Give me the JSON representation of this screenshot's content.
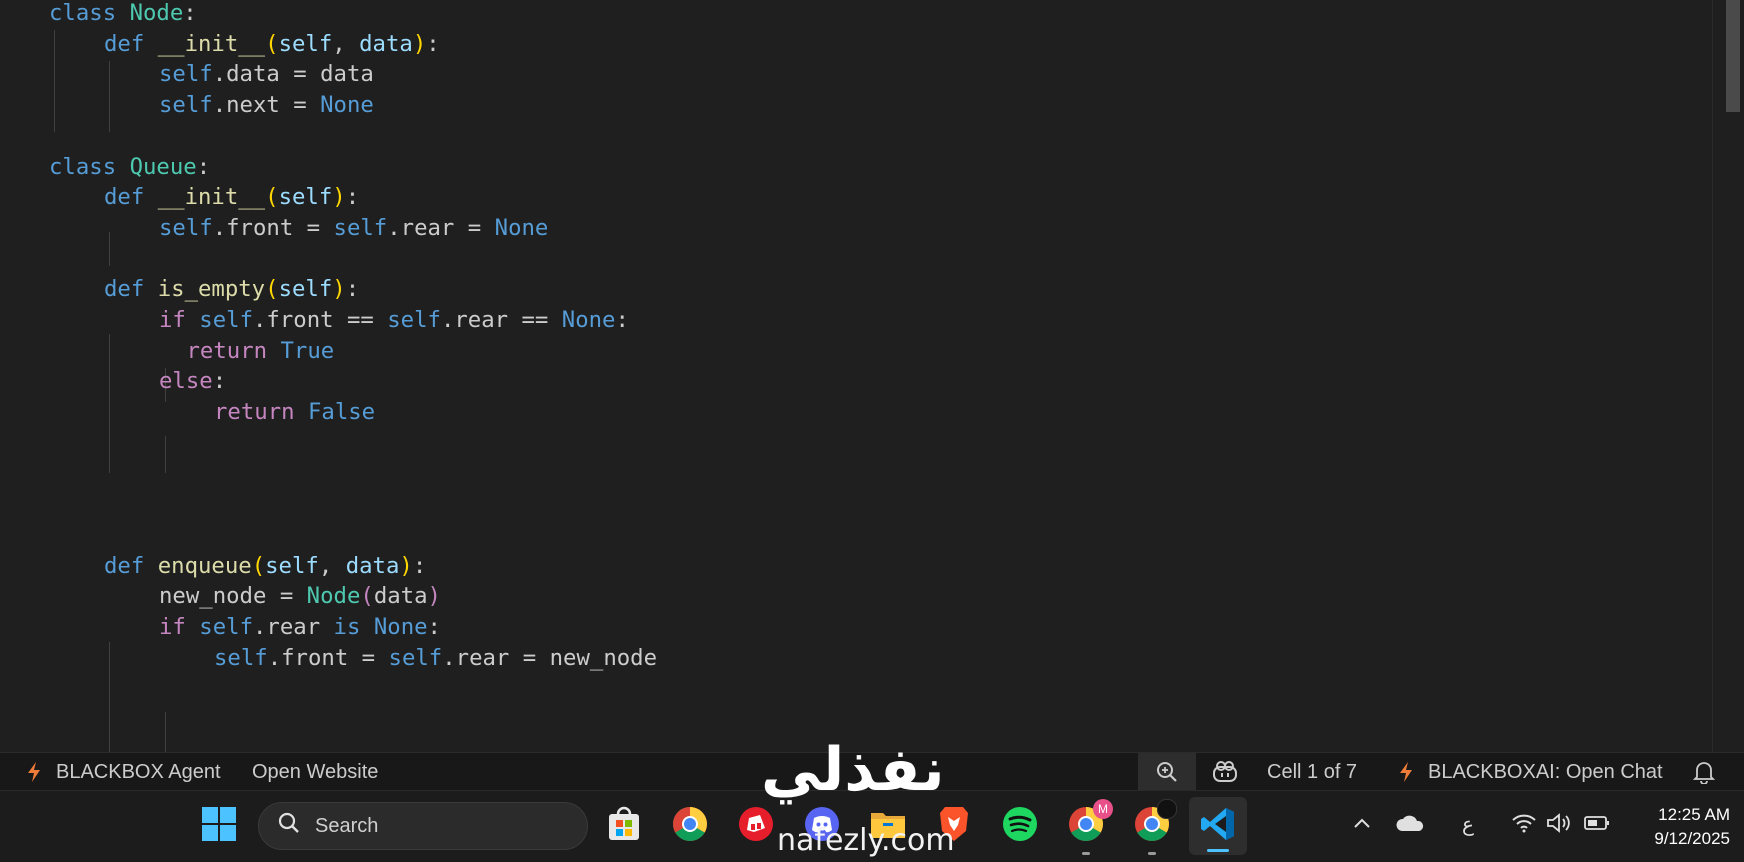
{
  "editor": {
    "code_lines": [
      {
        "indent": 1,
        "tokens": [
          {
            "t": "class",
            "c": "kw"
          },
          {
            "t": " "
          },
          {
            "t": "Node",
            "c": "cls"
          },
          {
            "t": ":"
          }
        ]
      },
      {
        "indent": 2,
        "tokens": [
          {
            "t": "def",
            "c": "kw"
          },
          {
            "t": " "
          },
          {
            "t": "__init__",
            "c": "fn"
          },
          {
            "t": "(",
            "c": "brk"
          },
          {
            "t": "self",
            "c": "prm"
          },
          {
            "t": ", "
          },
          {
            "t": "data",
            "c": "prm"
          },
          {
            "t": ")",
            "c": "brk"
          },
          {
            "t": ":"
          }
        ]
      },
      {
        "indent": 3,
        "tokens": [
          {
            "t": "self",
            "c": "slf"
          },
          {
            "t": ".data = data"
          }
        ]
      },
      {
        "indent": 3,
        "tokens": [
          {
            "t": "self",
            "c": "slf"
          },
          {
            "t": ".next = "
          },
          {
            "t": "None",
            "c": "const"
          }
        ]
      },
      {
        "indent": 0,
        "tokens": []
      },
      {
        "indent": 1,
        "tokens": [
          {
            "t": "class",
            "c": "kw"
          },
          {
            "t": " "
          },
          {
            "t": "Queue",
            "c": "cls"
          },
          {
            "t": ":"
          }
        ]
      },
      {
        "indent": 2,
        "tokens": [
          {
            "t": "def",
            "c": "kw"
          },
          {
            "t": " "
          },
          {
            "t": "__init__",
            "c": "fn"
          },
          {
            "t": "(",
            "c": "brk"
          },
          {
            "t": "self",
            "c": "prm"
          },
          {
            "t": ")",
            "c": "brk"
          },
          {
            "t": ":"
          }
        ]
      },
      {
        "indent": 3,
        "tokens": [
          {
            "t": "self",
            "c": "slf"
          },
          {
            "t": ".front = "
          },
          {
            "t": "self",
            "c": "slf"
          },
          {
            "t": ".rear = "
          },
          {
            "t": "None",
            "c": "const"
          }
        ]
      },
      {
        "indent": 0,
        "tokens": []
      },
      {
        "indent": 2,
        "tokens": [
          {
            "t": "def",
            "c": "kw"
          },
          {
            "t": " "
          },
          {
            "t": "is_empty",
            "c": "fn"
          },
          {
            "t": "(",
            "c": "brk"
          },
          {
            "t": "self",
            "c": "prm"
          },
          {
            "t": ")",
            "c": "brk"
          },
          {
            "t": ":"
          }
        ]
      },
      {
        "indent": 3,
        "tokens": [
          {
            "t": "if",
            "c": "ctl"
          },
          {
            "t": " "
          },
          {
            "t": "self",
            "c": "slf"
          },
          {
            "t": ".front == "
          },
          {
            "t": "self",
            "c": "slf"
          },
          {
            "t": ".rear == "
          },
          {
            "t": "None",
            "c": "const"
          },
          {
            "t": ":"
          }
        ]
      },
      {
        "indent": 3.5,
        "tokens": [
          {
            "t": "return",
            "c": "ctl"
          },
          {
            "t": " "
          },
          {
            "t": "True",
            "c": "const"
          }
        ]
      },
      {
        "indent": 3,
        "tokens": [
          {
            "t": "else",
            "c": "ctl"
          },
          {
            "t": ":"
          }
        ]
      },
      {
        "indent": 4,
        "tokens": [
          {
            "t": "return",
            "c": "ctl"
          },
          {
            "t": " "
          },
          {
            "t": "False",
            "c": "const"
          }
        ]
      },
      {
        "indent": 0,
        "tokens": []
      },
      {
        "indent": 0,
        "tokens": []
      },
      {
        "indent": 0,
        "tokens": []
      },
      {
        "indent": 0,
        "tokens": []
      },
      {
        "indent": 2,
        "tokens": [
          {
            "t": "def",
            "c": "kw"
          },
          {
            "t": " "
          },
          {
            "t": "enqueue",
            "c": "fn"
          },
          {
            "t": "(",
            "c": "brk"
          },
          {
            "t": "self",
            "c": "prm"
          },
          {
            "t": ", "
          },
          {
            "t": "data",
            "c": "prm"
          },
          {
            "t": ")",
            "c": "brk"
          },
          {
            "t": ":"
          }
        ]
      },
      {
        "indent": 3,
        "tokens": [
          {
            "t": "new_node = "
          },
          {
            "t": "Node",
            "c": "cls"
          },
          {
            "t": "(",
            "c": "ctl"
          },
          {
            "t": "data"
          },
          {
            "t": ")",
            "c": "ctl"
          }
        ]
      },
      {
        "indent": 3,
        "tokens": [
          {
            "t": "if",
            "c": "ctl"
          },
          {
            "t": " "
          },
          {
            "t": "self",
            "c": "slf"
          },
          {
            "t": ".rear "
          },
          {
            "t": "is",
            "c": "kw"
          },
          {
            "t": " "
          },
          {
            "t": "None",
            "c": "const"
          },
          {
            "t": ":"
          }
        ]
      },
      {
        "indent": 4,
        "tokens": [
          {
            "t": "self",
            "c": "slf"
          },
          {
            "t": ".front = "
          },
          {
            "t": "self",
            "c": "slf"
          },
          {
            "t": ".rear = new_node"
          }
        ]
      }
    ]
  },
  "status_bar": {
    "agent_label": "BLACKBOX Agent",
    "open_website_label": "Open Website",
    "cell_label": "Cell 1 of 7",
    "open_chat_label": "BLACKBOXAI: Open Chat"
  },
  "taskbar": {
    "search_label": "Search",
    "tray_lang": "ع",
    "clock_time": "12:25 AM",
    "clock_date": "9/12/2025",
    "chrome_badge": "M"
  },
  "watermark": {
    "arabic": "نفذلي",
    "latin": "nafezly.com"
  },
  "colors": {
    "editor_bg": "#1f1f1f",
    "keyword": "#569cd6",
    "control": "#c586c0",
    "class": "#4ec9b0",
    "function": "#dcdcaa",
    "param": "#9cdcfe",
    "bracket": "#ffd700",
    "accent": "#4cc2ff",
    "blackbox_orange": "#f07c3a"
  }
}
